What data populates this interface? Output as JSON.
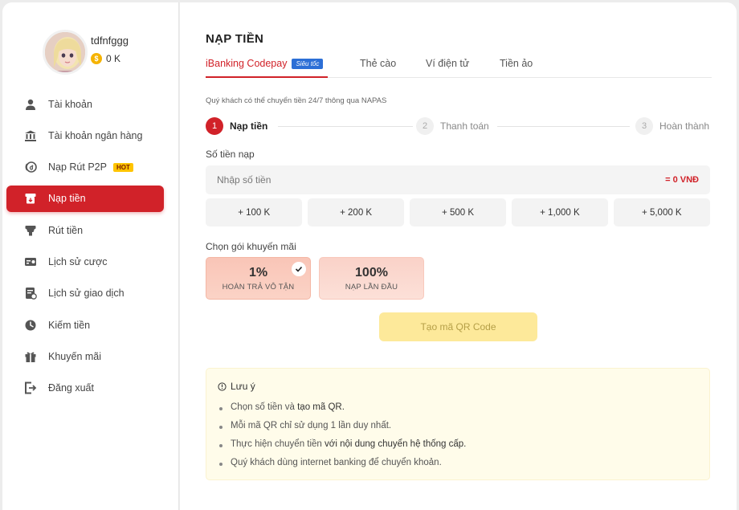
{
  "user": {
    "name": "tdfnfggg",
    "balance": "0 K"
  },
  "sidebar": {
    "items": [
      {
        "label": "Tài khoản",
        "icon": "user-icon"
      },
      {
        "label": "Tài khoản ngân hàng",
        "icon": "bank-icon"
      },
      {
        "label": "Nạp Rút P2P",
        "icon": "p2p-coin-icon",
        "badge": "HOT"
      },
      {
        "label": "Nạp tiền",
        "icon": "deposit-icon",
        "active": true
      },
      {
        "label": "Rút tiền",
        "icon": "withdraw-icon"
      },
      {
        "label": "Lịch sử cược",
        "icon": "bet-history-icon"
      },
      {
        "label": "Lịch sử giao dịch",
        "icon": "transaction-history-icon"
      },
      {
        "label": "Kiếm tiền",
        "icon": "earn-icon"
      },
      {
        "label": "Khuyến mãi",
        "icon": "gift-icon"
      },
      {
        "label": "Đăng xuất",
        "icon": "logout-icon"
      }
    ]
  },
  "main": {
    "title": "NẠP TIỀN",
    "tabs": [
      {
        "label": "iBanking Codepay",
        "badge": "Siêu tốc",
        "active": true
      },
      {
        "label": "Thẻ cào"
      },
      {
        "label": "Ví điện tử"
      },
      {
        "label": "Tiền ảo"
      }
    ],
    "hint": "Quý khách có thể chuyển tiền 24/7 thông qua NAPAS",
    "steps": [
      {
        "num": "1",
        "label": "Nạp tiền",
        "active": true
      },
      {
        "num": "2",
        "label": "Thanh toán"
      },
      {
        "num": "3",
        "label": "Hoàn thành"
      }
    ],
    "amount": {
      "label": "Số tiền nạp",
      "placeholder": "Nhập số tiền",
      "value": "",
      "converted": "= 0 VNĐ"
    },
    "quick_amounts": [
      "+ 100 K",
      "+ 200 K",
      "+ 500 K",
      "+ 1,000 K",
      "+ 5,000 K"
    ],
    "promo": {
      "label": "Chọn gói khuyến mãi",
      "options": [
        {
          "pct": "1%",
          "text": "HOÀN TRẢ VÔ TẬN",
          "selected": true
        },
        {
          "pct": "100%",
          "text": "NẠP LẦN ĐẦU",
          "selected": false
        }
      ]
    },
    "qr_button": "Tạo mã QR Code",
    "note": {
      "title": "Lưu ý",
      "items": [
        {
          "pre": "Chọn số tiền và ",
          "bold": "tạo mã QR."
        },
        {
          "pre": "Mỗi mã QR chỉ sử dụng 1 lần duy nhất.",
          "bold": ""
        },
        {
          "pre": "Thực hiện chuyển tiền ",
          "bold": "với nội dung chuyển hệ thống cấp."
        },
        {
          "pre": "Quý khách dùng internet banking để chuyển khoản.",
          "bold": ""
        }
      ]
    }
  },
  "colors": {
    "accent": "#d12229",
    "qr_button": "#fde99a",
    "note_bg": "#fffcea",
    "badge_blue": "#2c6fd6",
    "hot_badge": "#ffc400"
  }
}
